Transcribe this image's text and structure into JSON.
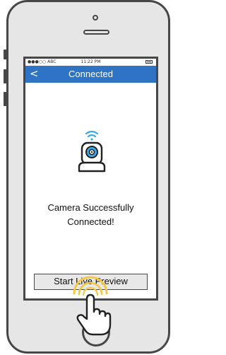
{
  "status_bar": {
    "carrier": "●●●○○ ABC",
    "time": "11:22 PM",
    "battery_icon": "battery-icon"
  },
  "nav": {
    "back_label": "<",
    "title": "Connected"
  },
  "main": {
    "camera_icon": "wifi-camera-icon",
    "success_line_1": "Camera Successfully",
    "success_line_2": "Connected!",
    "start_button_label": "Start Live Preview"
  },
  "gesture": {
    "icon": "tap-hand-icon"
  },
  "colors": {
    "nav_blue": "#2f74c4",
    "wifi_blue": "#3aa9e8",
    "tap_glow": "#f5c842",
    "outline": "#474747"
  }
}
